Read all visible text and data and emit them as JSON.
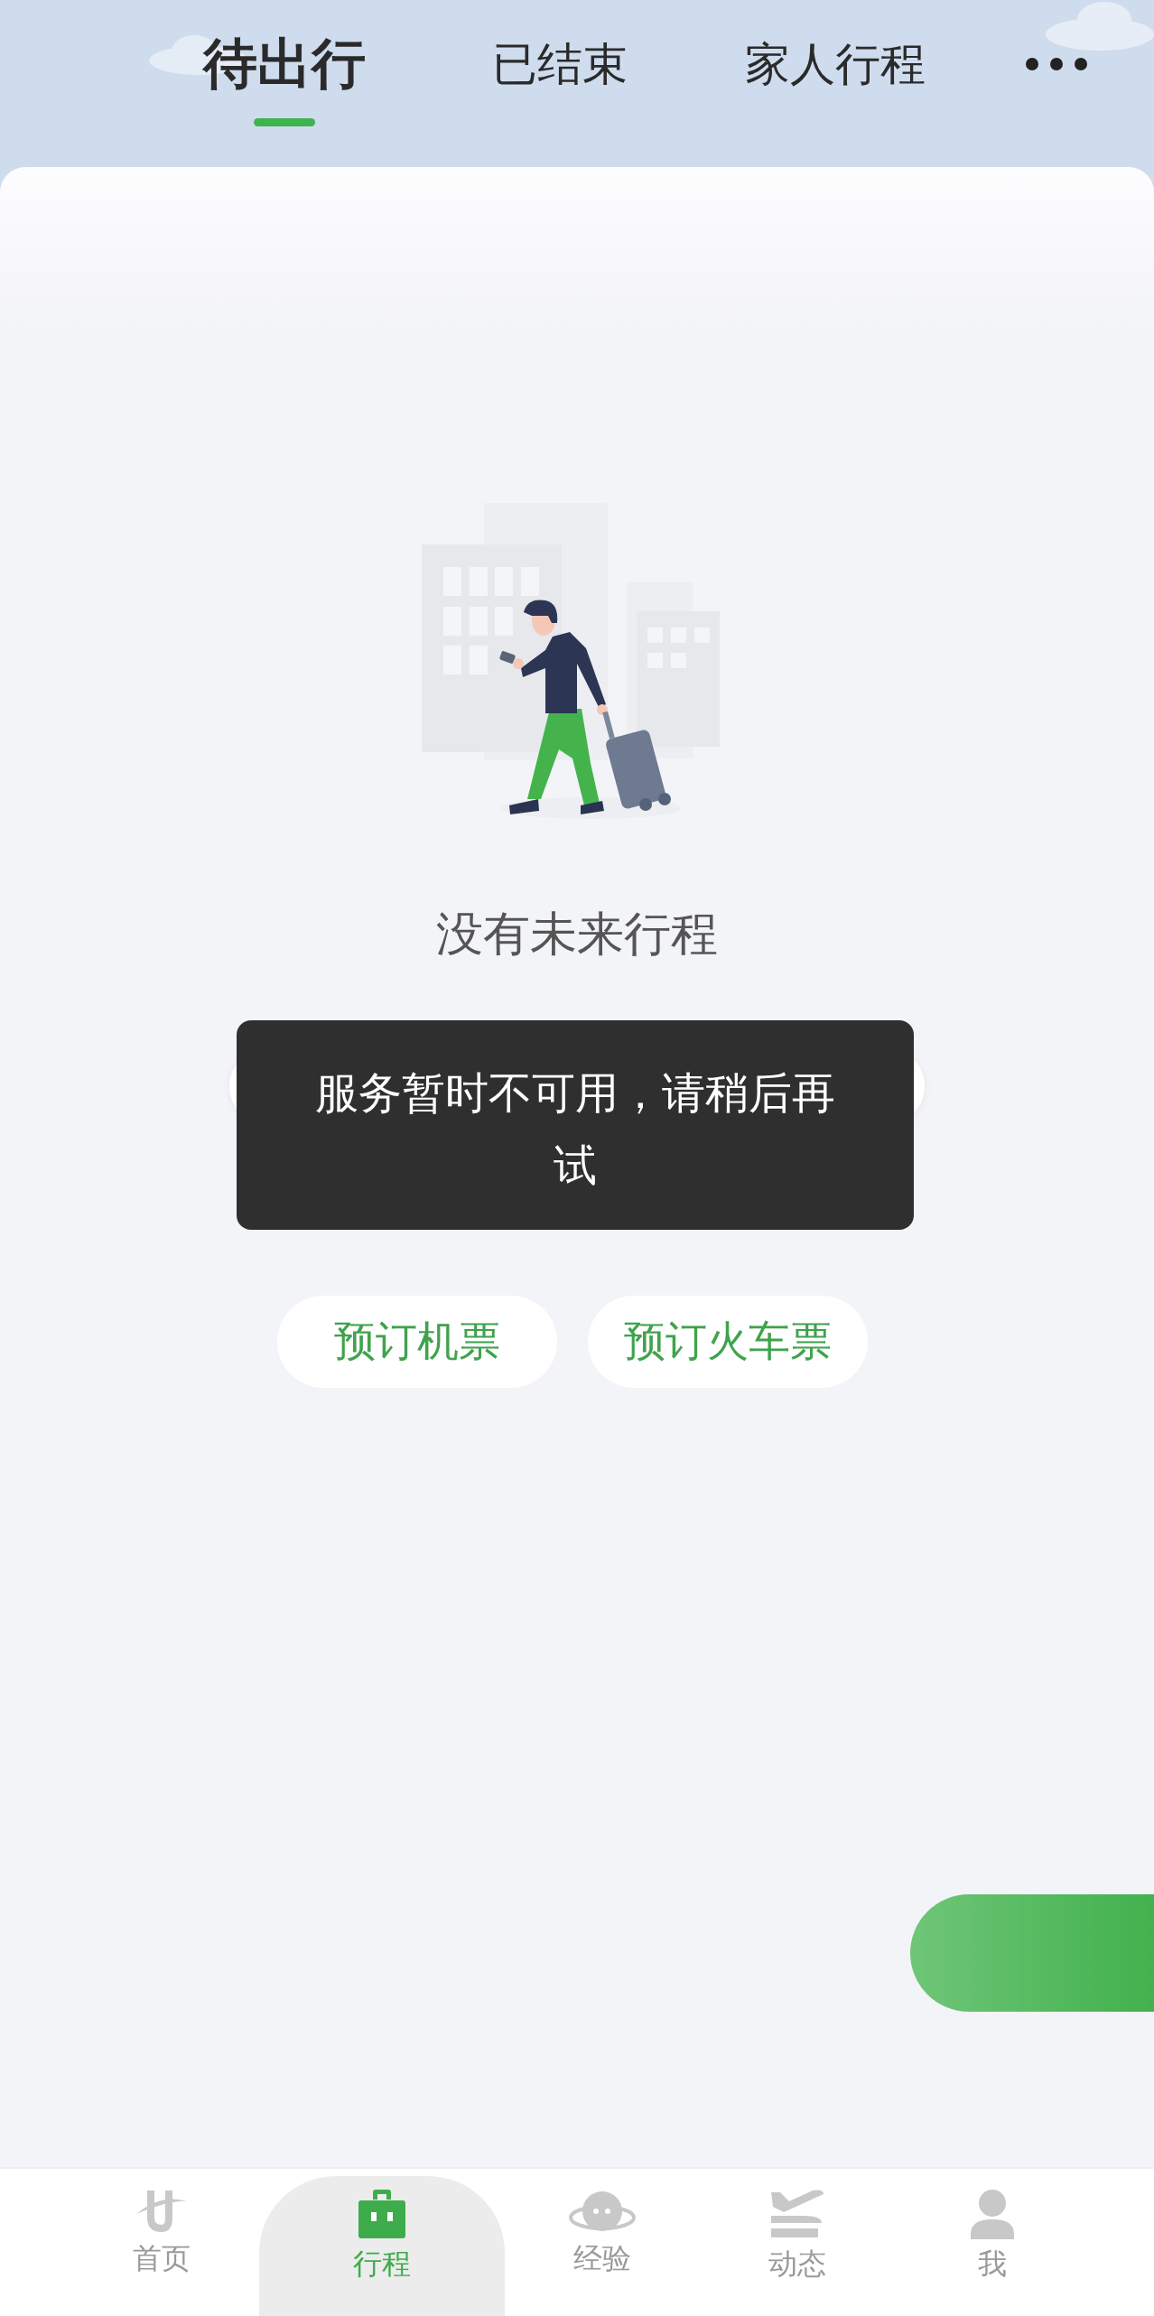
{
  "tabs": [
    {
      "label": "待出行",
      "selected": true
    },
    {
      "label": "已结束",
      "selected": false
    },
    {
      "label": "家人行程",
      "selected": false
    }
  ],
  "empty_state": {
    "title": "没有未来行程"
  },
  "toast": {
    "message": "服务暂时不可用，请稍后再试"
  },
  "booking_buttons": [
    {
      "label": "预订机票"
    },
    {
      "label": "预订火车票"
    }
  ],
  "bottom_nav": [
    {
      "kind": "home",
      "label": "首页",
      "selected": false
    },
    {
      "kind": "trips",
      "label": "行程",
      "selected": true
    },
    {
      "kind": "experience",
      "label": "经验",
      "selected": false
    },
    {
      "kind": "flights",
      "label": "动态",
      "selected": false
    },
    {
      "kind": "me",
      "label": "我",
      "selected": false
    }
  ]
}
